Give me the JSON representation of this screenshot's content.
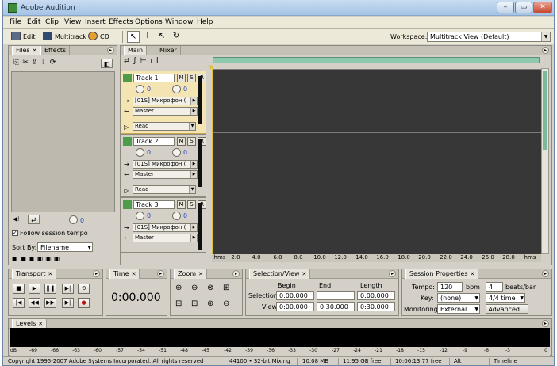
{
  "app": {
    "title": "Adobe Audition",
    "window_buttons": [
      "–",
      "▭",
      "✕"
    ]
  },
  "menu": [
    "File",
    "Edit",
    "Clip",
    "View",
    "Insert",
    "Effects",
    "Options",
    "Window",
    "Help"
  ],
  "toolbar": {
    "edit_label": "Edit",
    "multitrack_label": "Multitrack",
    "cd_label": "CD",
    "workspace_label": "Workspace:",
    "workspace_value": "Multitrack View (Default)"
  },
  "files_panel": {
    "tab_files": "Files",
    "tab_effects": "Effects",
    "volume_value": "0",
    "follow_label": "Follow session tempo",
    "sort_label": "Sort By:",
    "sort_value": "Filename"
  },
  "main_panel": {
    "tab_main": "Main",
    "tab_mixer": "Mixer"
  },
  "tracks": [
    {
      "name": "Track 1",
      "m": "M",
      "s": "S",
      "r": "R",
      "vol": "0",
      "pan": "0",
      "input": "[01S] Микрофон (",
      "output": "Master",
      "automation": "Read"
    },
    {
      "name": "Track 2",
      "m": "M",
      "s": "S",
      "r": "R",
      "vol": "0",
      "pan": "0",
      "input": "[01S] Микрофон (",
      "output": "Master",
      "automation": "Read"
    },
    {
      "name": "Track 3",
      "m": "M",
      "s": "S",
      "r": "R",
      "vol": "0",
      "pan": "0",
      "input": "[01S] Микрофон (",
      "output": "Master",
      "automation": "Read"
    }
  ],
  "ruler": {
    "unit": "hms",
    "ticks": [
      "2.0",
      "4.0",
      "6.0",
      "8.0",
      "10.0",
      "12.0",
      "14.0",
      "16.0",
      "18.0",
      "20.0",
      "22.0",
      "24.0",
      "26.0",
      "28.0"
    ],
    "unit_end": "hms"
  },
  "transport": {
    "tab": "Transport"
  },
  "time": {
    "tab": "Time",
    "value": "0:00.000"
  },
  "zoom": {
    "tab": "Zoom"
  },
  "selection": {
    "tab": "Selection/View",
    "col_begin": "Begin",
    "col_end": "End",
    "col_length": "Length",
    "row_selection": "Selection",
    "row_view": "View",
    "sel_begin": "0:00.000",
    "sel_end": "",
    "sel_length": "0:00.000",
    "view_begin": "0:00.000",
    "view_end": "0:30.000",
    "view_length": "0:30.000"
  },
  "session": {
    "tab": "Session Properties",
    "tempo_label": "Tempo:",
    "tempo_value": "120",
    "bpm_label": "bpm",
    "beats_value": "4",
    "beats_label": "beats/bar",
    "key_label": "Key:",
    "key_value": "(none)",
    "time_sig": "4/4 time",
    "monitoring_label": "Monitoring:",
    "monitoring_value": "External",
    "advanced": "Advanced..."
  },
  "levels": {
    "tab": "Levels",
    "scale": [
      "dB",
      "-69",
      "-66",
      "-63",
      "-60",
      "-57",
      "-54",
      "-51",
      "-48",
      "-45",
      "-42",
      "-39",
      "-36",
      "-33",
      "-30",
      "-27",
      "-24",
      "-21",
      "-18",
      "-15",
      "-12",
      "-9",
      "-6",
      "-3",
      "0"
    ]
  },
  "status": {
    "copyright": "Copyright 1995-2007 Adobe Systems Incorporated. All rights reserved",
    "format": "44100 • 32-bit Mixing",
    "mem": "10.08 MB",
    "disk": "11.95 GB free",
    "time_free": "10:06:13.77 free",
    "alt": "Alt",
    "view": "Timeline"
  }
}
